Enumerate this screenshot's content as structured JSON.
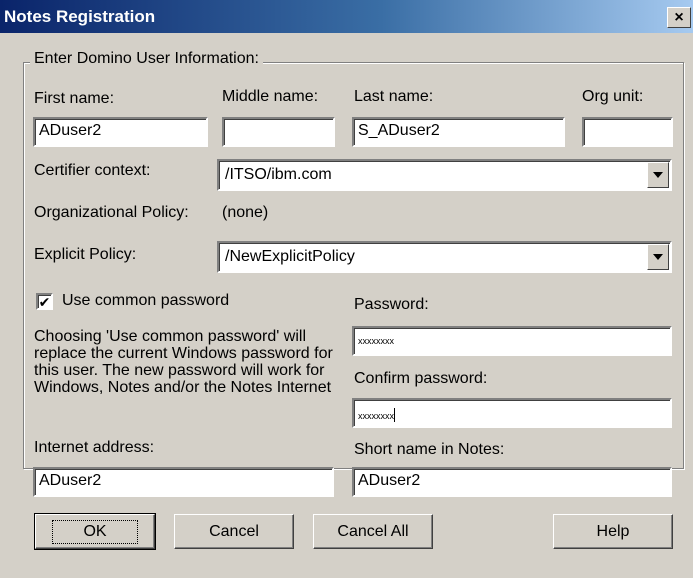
{
  "window": {
    "title": "Notes Registration",
    "close_label": "×"
  },
  "group": {
    "legend": "Enter Domino User Information:"
  },
  "labels": {
    "first_name": "First name:",
    "middle_name": "Middle name:",
    "last_name": "Last name:",
    "org_unit": "Org unit:",
    "certifier_context": "Certifier context:",
    "org_policy": "Organizational Policy:",
    "org_policy_value": "(none)",
    "explicit_policy": "Explicit Policy:",
    "use_common_password": "Use common password",
    "password": "Password:",
    "confirm_password": "Confirm password:",
    "internet_address": "Internet address:",
    "short_name": "Short name in Notes:"
  },
  "fields": {
    "first_name": "ADuser2",
    "middle_name": "",
    "last_name": "S_ADuser2",
    "org_unit": "",
    "certifier_context": "/ITSO/ibm.com",
    "explicit_policy": "/NewExplicitPolicy",
    "password": "xxxxxxxx",
    "confirm_password": "xxxxxxxx",
    "internet_address": "ADuser2",
    "short_name": "ADuser2"
  },
  "checkbox": {
    "use_common_password_checked": true,
    "mark": "✔"
  },
  "help_text": "Choosing 'Use common password' will replace the current Windows password for this user.  The new password will work for Windows, Notes and/or the Notes Internet",
  "buttons": {
    "ok": "OK",
    "cancel": "Cancel",
    "cancel_all": "Cancel All",
    "help": "Help"
  },
  "icons": {
    "close": "close-icon",
    "dropdown": "chevron-down-icon",
    "check": "checkmark-icon"
  }
}
